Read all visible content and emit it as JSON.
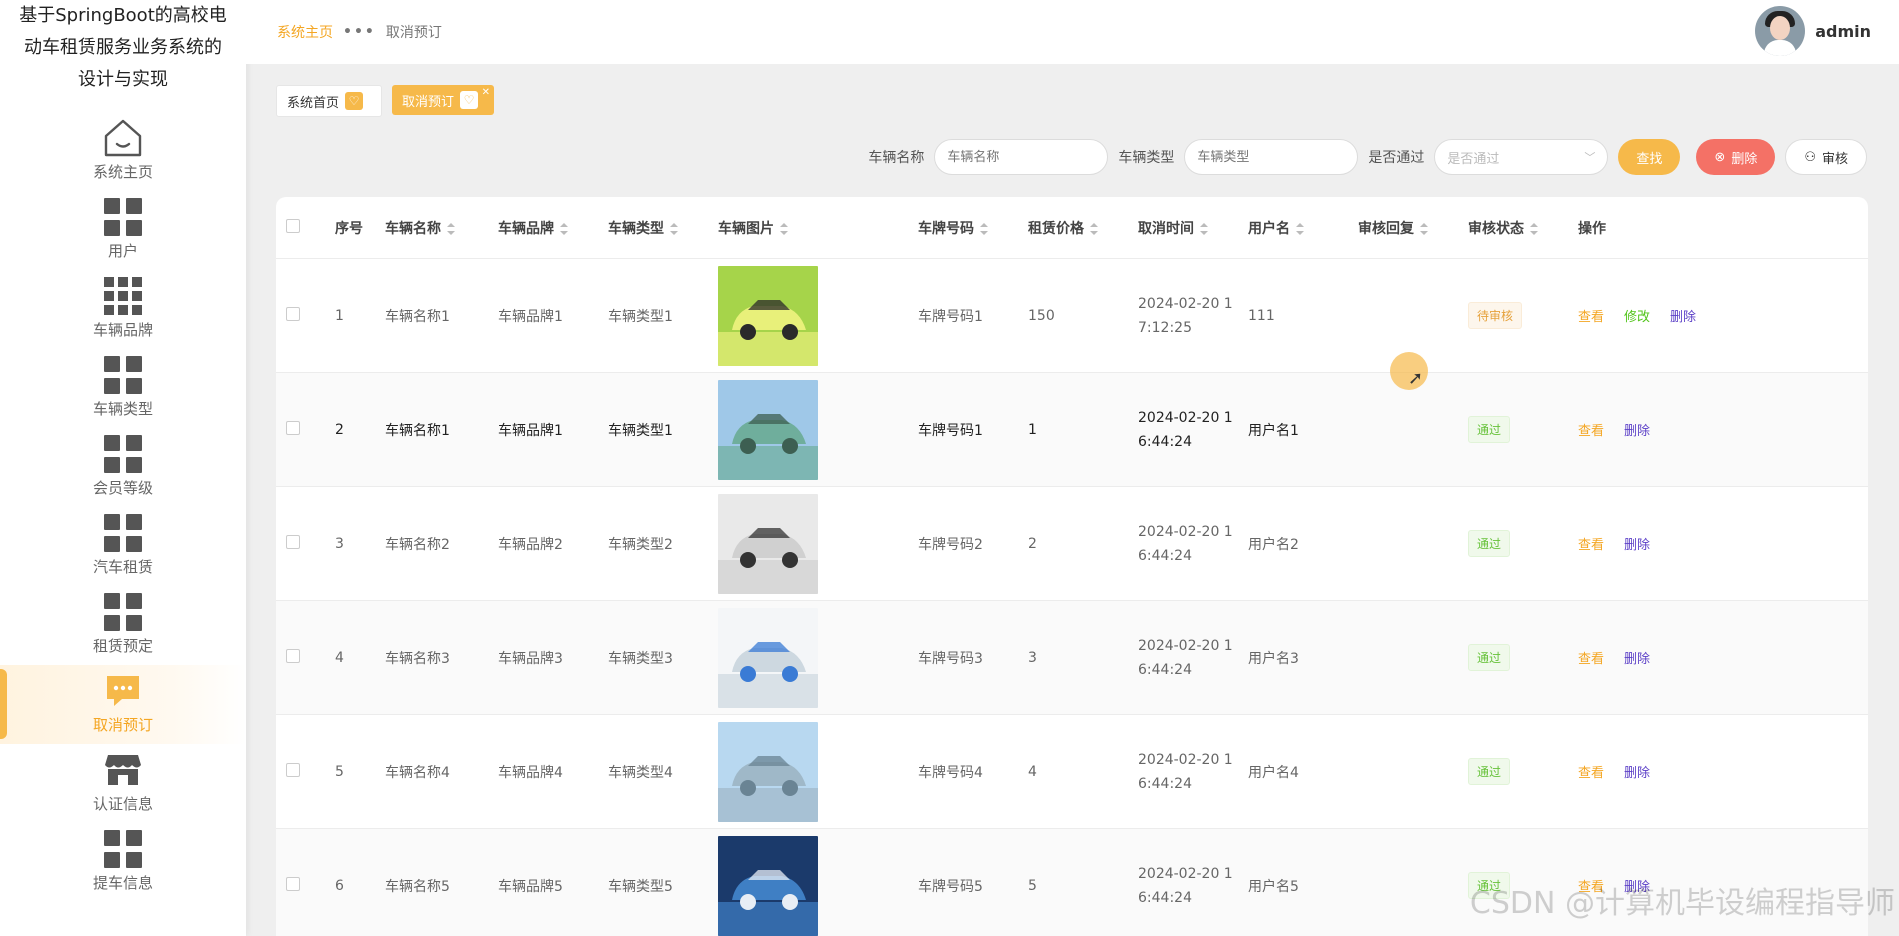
{
  "app": {
    "title_line1": "基于SpringBoot的高校电",
    "title_line2": "动车租赁服务业务系统的",
    "title_line3": "设计与实现"
  },
  "sidebar": {
    "items": [
      {
        "label": "系统主页",
        "icon": "home-icon"
      },
      {
        "label": "用户",
        "icon": "grid-icon"
      },
      {
        "label": "车辆品牌",
        "icon": "grid9-icon"
      },
      {
        "label": "车辆类型",
        "icon": "grid-icon"
      },
      {
        "label": "会员等级",
        "icon": "grid-icon"
      },
      {
        "label": "汽车租赁",
        "icon": "grid-icon"
      },
      {
        "label": "租赁预定",
        "icon": "grid-icon"
      },
      {
        "label": "取消预订",
        "icon": "chat-icon",
        "active": true
      },
      {
        "label": "认证信息",
        "icon": "store-icon"
      },
      {
        "label": "提车信息",
        "icon": "grid-icon"
      }
    ]
  },
  "header": {
    "breadcrumb_home": "系统主页",
    "breadcrumb_current": "取消预订",
    "username": "admin"
  },
  "tabs": [
    {
      "label": "系统首页"
    },
    {
      "label": "取消预订"
    }
  ],
  "search": {
    "name_label": "车辆名称",
    "name_placeholder": "车辆名称",
    "type_label": "车辆类型",
    "type_placeholder": "车辆类型",
    "pass_label": "是否通过",
    "pass_placeholder": "是否通过",
    "search_btn": "查找",
    "delete_btn": "删除",
    "audit_btn": "审核"
  },
  "table": {
    "headers": [
      "序号",
      "车辆名称",
      "车辆品牌",
      "车辆类型",
      "车辆图片",
      "车牌号码",
      "租赁价格",
      "取消时间",
      "用户名",
      "审核回复",
      "审核状态",
      "操作"
    ],
    "ops": {
      "view": "查看",
      "edit": "修改",
      "delete": "删除"
    },
    "rows": [
      {
        "no": "1",
        "name": "车辆名称1",
        "brand": "车辆品牌1",
        "type": "车辆类型1",
        "plate": "车牌号码1",
        "price": "150",
        "time1": "2024-02-20 1",
        "time2": "7:12:25",
        "user": "111",
        "reply": "",
        "status": "待审核",
        "statusType": "pending",
        "canEdit": true,
        "img": [
          "#a6d44a",
          "#e8f07a",
          "#2a2a2a"
        ]
      },
      {
        "no": "2",
        "name": "车辆名称1",
        "brand": "车辆品牌1",
        "type": "车辆类型1",
        "plate": "车牌号码1",
        "price": "1",
        "time1": "2024-02-20 1",
        "time2": "6:44:24",
        "user": "用户名1",
        "reply": "",
        "status": "通过",
        "statusType": "pass",
        "canEdit": false,
        "img": [
          "#9fc8e8",
          "#6fae9c",
          "#3d5f52"
        ]
      },
      {
        "no": "3",
        "name": "车辆名称2",
        "brand": "车辆品牌2",
        "type": "车辆类型2",
        "plate": "车牌号码2",
        "price": "2",
        "time1": "2024-02-20 1",
        "time2": "6:44:24",
        "user": "用户名2",
        "reply": "",
        "status": "通过",
        "statusType": "pass",
        "canEdit": false,
        "img": [
          "#e9e9e9",
          "#d0d0d0",
          "#333333"
        ]
      },
      {
        "no": "4",
        "name": "车辆名称3",
        "brand": "车辆品牌3",
        "type": "车辆类型3",
        "plate": "车牌号码3",
        "price": "3",
        "time1": "2024-02-20 1",
        "time2": "6:44:24",
        "user": "用户名3",
        "reply": "",
        "status": "通过",
        "statusType": "pass",
        "canEdit": false,
        "img": [
          "#f4f6f8",
          "#cdd8e0",
          "#3a7bd5"
        ]
      },
      {
        "no": "5",
        "name": "车辆名称4",
        "brand": "车辆品牌4",
        "type": "车辆类型4",
        "plate": "车牌号码4",
        "price": "4",
        "time1": "2024-02-20 1",
        "time2": "6:44:24",
        "user": "用户名4",
        "reply": "",
        "status": "通过",
        "statusType": "pass",
        "canEdit": false,
        "img": [
          "#b8d8f0",
          "#9fb8c8",
          "#6a8494"
        ]
      },
      {
        "no": "6",
        "name": "车辆名称5",
        "brand": "车辆品牌5",
        "type": "车辆类型5",
        "plate": "车牌号码5",
        "price": "5",
        "time1": "2024-02-20 1",
        "time2": "6:44:24",
        "user": "用户名5",
        "reply": "",
        "status": "通过",
        "statusType": "pass",
        "canEdit": false,
        "img": [
          "#1b3a6b",
          "#3f7fc4",
          "#e8eef5"
        ]
      }
    ]
  },
  "colors": {
    "accent": "#f6b94a",
    "danger": "#f47166",
    "success": "#67c23a",
    "warning": "#e6a23c"
  },
  "watermark": "CSDN @计算机毕设编程指导师"
}
